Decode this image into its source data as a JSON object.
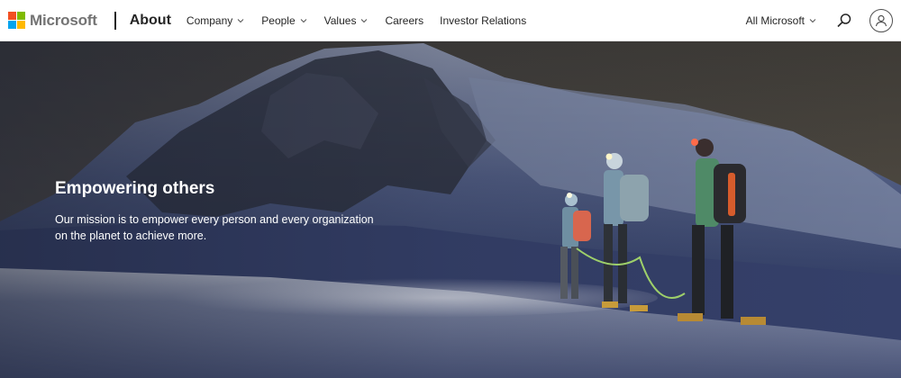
{
  "header": {
    "logo_text": "Microsoft",
    "section_title": "About",
    "nav": [
      {
        "label": "Company",
        "has_dropdown": true
      },
      {
        "label": "People",
        "has_dropdown": true
      },
      {
        "label": "Values",
        "has_dropdown": true
      },
      {
        "label": "Careers",
        "has_dropdown": false
      },
      {
        "label": "Investor Relations",
        "has_dropdown": false
      }
    ],
    "all_microsoft": "All Microsoft",
    "icons": {
      "search": "search-icon",
      "account": "person-icon",
      "dropdown": "chevron-down-icon"
    },
    "logo_colors": [
      "#f25022",
      "#7fba00",
      "#00a4ef",
      "#ffb900"
    ]
  },
  "hero": {
    "title": "Empowering others",
    "text": "Our mission is to empower every person and every organization on the planet to achieve more."
  }
}
